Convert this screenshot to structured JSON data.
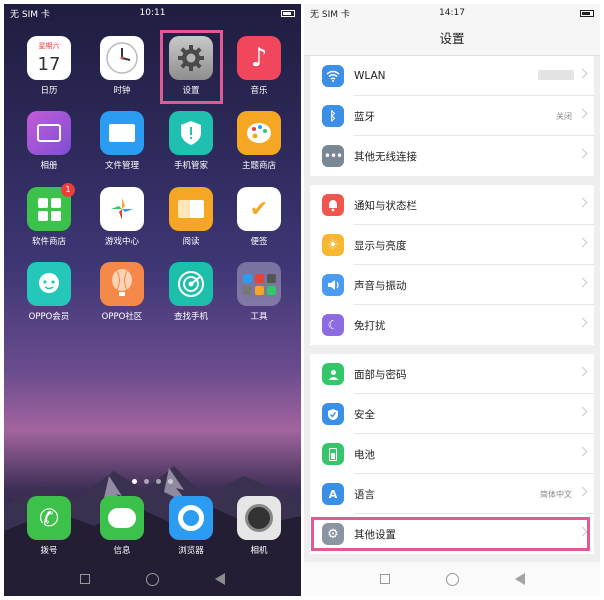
{
  "left_phone": {
    "status": {
      "carrier": "无 SIM 卡",
      "time": "10:11"
    },
    "apps": [
      {
        "label": "日历",
        "icon": "calendar-icon",
        "weekday": "星期六",
        "day": "17"
      },
      {
        "label": "时钟",
        "icon": "clock-icon"
      },
      {
        "label": "设置",
        "icon": "gear-icon"
      },
      {
        "label": "音乐",
        "icon": "music-icon"
      },
      {
        "label": "相册",
        "icon": "photo-icon"
      },
      {
        "label": "文件管理",
        "icon": "folder-icon"
      },
      {
        "label": "手机管家",
        "icon": "shield-icon"
      },
      {
        "label": "主题商店",
        "icon": "palette-icon"
      },
      {
        "label": "软件商店",
        "icon": "store-icon",
        "badge": "1"
      },
      {
        "label": "游戏中心",
        "icon": "game-icon"
      },
      {
        "label": "阅读",
        "icon": "book-icon"
      },
      {
        "label": "便签",
        "icon": "note-icon"
      },
      {
        "label": "OPPO会员",
        "icon": "member-icon"
      },
      {
        "label": "OPPO社区",
        "icon": "balloon-icon"
      },
      {
        "label": "查找手机",
        "icon": "radar-icon"
      },
      {
        "label": "工具",
        "icon": "tools-folder-icon"
      }
    ],
    "dock": [
      {
        "label": "拨号",
        "icon": "phone-icon"
      },
      {
        "label": "信息",
        "icon": "message-icon"
      },
      {
        "label": "浏览器",
        "icon": "browser-icon"
      },
      {
        "label": "相机",
        "icon": "camera-icon"
      }
    ]
  },
  "right_phone": {
    "status": {
      "carrier": "无 SIM 卡",
      "time": "14:17"
    },
    "title": "设置",
    "groups": [
      [
        {
          "label": "WLAN",
          "icon": "wifi-icon",
          "color": "#3b8fe5"
        },
        {
          "label": "蓝牙",
          "icon": "bluetooth-icon",
          "color": "#3b8fe5",
          "value": "关闭"
        },
        {
          "label": "其他无线连接",
          "icon": "more-icon",
          "color": "#7a8796"
        }
      ],
      [
        {
          "label": "通知与状态栏",
          "icon": "bell-icon",
          "color": "#f0554e"
        },
        {
          "label": "显示与亮度",
          "icon": "sun-icon",
          "color": "#f7b731"
        },
        {
          "label": "声音与振动",
          "icon": "speaker-icon",
          "color": "#4b9cf0"
        },
        {
          "label": "免打扰",
          "icon": "moon-icon",
          "color": "#8c6ce0"
        }
      ],
      [
        {
          "label": "面部与密码",
          "icon": "face-icon",
          "color": "#35c56b"
        },
        {
          "label": "安全",
          "icon": "shield-check-icon",
          "color": "#3b8fe5"
        },
        {
          "label": "电池",
          "icon": "battery-icon",
          "color": "#35c56b"
        },
        {
          "label": "语言",
          "icon": "language-icon",
          "color": "#3b8fe5",
          "value": "简体中文"
        },
        {
          "label": "其他设置",
          "icon": "gear-icon",
          "color": "#8a95a3"
        }
      ]
    ]
  }
}
